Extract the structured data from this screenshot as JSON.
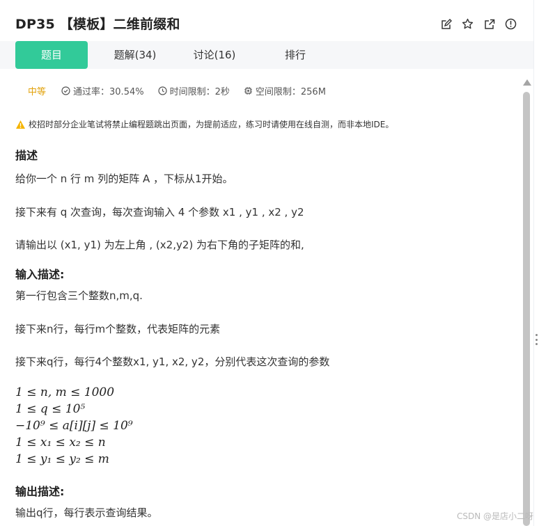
{
  "header": {
    "title": "DP35 【模板】二维前缀和",
    "icons": [
      "edit-icon",
      "star-icon",
      "external-link-icon",
      "info-icon"
    ]
  },
  "tabs": [
    {
      "label": "题目",
      "active": true
    },
    {
      "label": "题解(34)",
      "active": false
    },
    {
      "label": "讨论(16)",
      "active": false
    },
    {
      "label": "排行",
      "active": false
    }
  ],
  "meta": {
    "difficulty": "中等",
    "pass_rate": "通过率：30.54%",
    "time_limit": "时间限制：2秒",
    "space_limit": "空间限制：256M"
  },
  "notice": "校招时部分企业笔试将禁止编程题跳出页面，为提前适应，练习时请使用在线自测，而非本地IDE。",
  "description": {
    "heading": "描述",
    "lines": [
      "给你一个 n 行 m 列的矩阵 A ，下标从1开始。",
      "接下来有 q 次查询，每次查询输入 4 个参数 x1 , y1 , x2 , y2",
      "请输出以 (x1, y1) 为左上角 , (x2,y2) 为右下角的子矩阵的和,"
    ]
  },
  "input": {
    "heading": "输入描述:",
    "lines": [
      "第一行包含三个整数n,m,q.",
      "接下来n行，每行m个整数，代表矩阵的元素",
      "接下来q行，每行4个整数x1, y1, x2, y2，分别代表这次查询的参数"
    ],
    "constraints": [
      "1 ≤ n, m ≤ 1000",
      "1 ≤ q ≤ 10⁵",
      "−10⁹ ≤ a[i][j] ≤ 10⁹",
      "1 ≤ x₁ ≤ x₂ ≤ n",
      "1 ≤ y₁ ≤ y₂ ≤ m"
    ]
  },
  "output": {
    "heading": "输出描述:",
    "lines": [
      "输出q行，每行表示查询结果。"
    ]
  },
  "watermark": "CSDN @是店小二呀",
  "colors": {
    "accent": "#32ca99",
    "difficulty": "#e2a20b",
    "warning": "#f5b400"
  }
}
